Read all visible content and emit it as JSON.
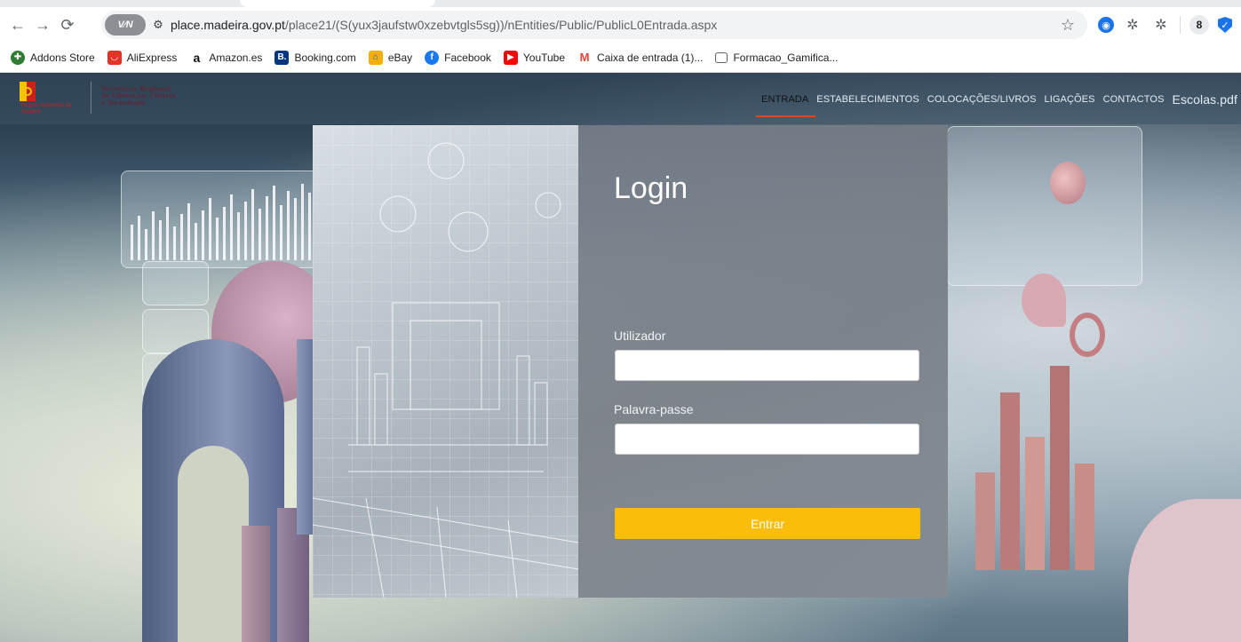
{
  "browser": {
    "url_host": "place.madeira.gov.pt",
    "url_path": "/place21/(S(yux3jaufstw0xzebvtgls5sg))/nEntities/Public/PublicL0Entrada.aspx",
    "vpn_label": "V∕N",
    "profile_initial": "8",
    "bookmarks": [
      {
        "label": "Addons Store",
        "icon": "addons-icon",
        "color": "#2e7d32"
      },
      {
        "label": "AliExpress",
        "icon": "aliexpress-icon",
        "color": "#e43225"
      },
      {
        "label": "Amazon.es",
        "icon": "amazon-icon",
        "color": "#111111"
      },
      {
        "label": "Booking.com",
        "icon": "booking-icon",
        "color": "#003580"
      },
      {
        "label": "eBay",
        "icon": "ebay-icon",
        "color": "#f5af02"
      },
      {
        "label": "Facebook",
        "icon": "facebook-icon",
        "color": "#1877f2"
      },
      {
        "label": "YouTube",
        "icon": "youtube-icon",
        "color": "#ff0000"
      },
      {
        "label": "Caixa de entrada (1)...",
        "icon": "gmail-icon",
        "color": "#ea4335"
      },
      {
        "label": "Formacao_Gamifica...",
        "icon": "folder-icon",
        "color": "#5f6368"
      }
    ]
  },
  "site": {
    "secretaria": [
      "Secretaria Regional",
      "de Educação, Ciência",
      "e Tecnologia"
    ],
    "nav": [
      "ENTRADA",
      "ESTABELECIMENTOS",
      "COLOCAÇÕES/LIVROS",
      "LIGAÇÕES",
      "CONTACTOS",
      "Escolas.pdf"
    ],
    "active_nav": "ENTRADA"
  },
  "login": {
    "title": "Login",
    "user_label": "Utilizador",
    "user_value": "",
    "password_label": "Palavra-passe",
    "password_value": "",
    "submit_label": "Entrar",
    "accent": "#fbbd08"
  }
}
